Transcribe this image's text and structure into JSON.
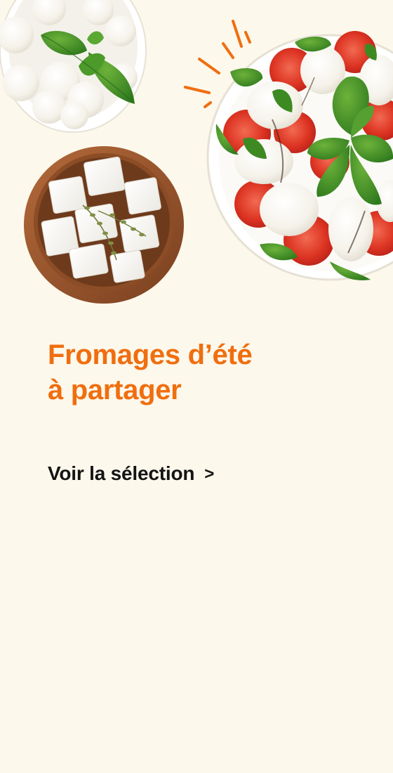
{
  "banner": {
    "title_line1": "Fromages d’été",
    "title_line2": "à partager",
    "cta_label": "Voir la sélection",
    "cta_chevron": ">"
  },
  "colors": {
    "background": "#fdf8ec",
    "title": "#f06e0f",
    "cta_text": "#141414",
    "accent_burst": "#f06e0f"
  },
  "images": {
    "top_left": "mozzarella-pearls-bowl",
    "middle_left": "feta-cubes-wooden-bowl",
    "right": "caprese-salad-plate"
  },
  "icons": {
    "cta": "chevron-right-icon",
    "decor": "sparkle-burst-icon"
  }
}
